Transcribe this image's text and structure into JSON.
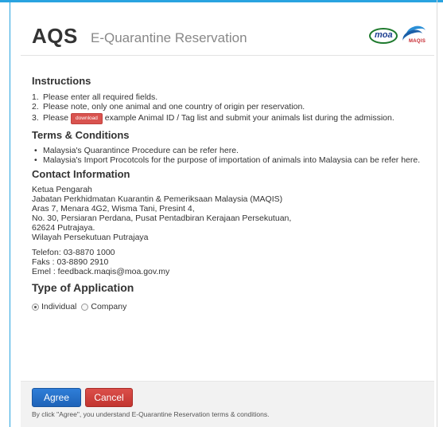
{
  "header": {
    "title_main": "AQS",
    "title_sub": "E-Quarantine Reservation",
    "logo_moa": "moa",
    "logo_maqis": "MAQIS"
  },
  "instructions": {
    "heading": "Instructions",
    "items": [
      {
        "num": "1.",
        "text": "Please enter all required fields."
      },
      {
        "num": "2.",
        "text": "Please note, only one animal and one country of origin per reservation."
      },
      {
        "num": "3.",
        "pre": "Please",
        "button": "download",
        "post": "example Animal ID / Tag list and submit your animals list during the admission."
      }
    ]
  },
  "terms": {
    "heading": "Terms & Conditions",
    "items": [
      "Malaysia's Quarantince Procedure can be refer here.",
      "Malaysia's Import Procotcols for the purpose of importation of animals into Malaysia can be refer here."
    ]
  },
  "contact": {
    "heading": "Contact Information",
    "address": [
      "Ketua Pengarah",
      "Jabatan Perkhidmatan Kuarantin & Pemeriksaan Malaysia (MAQIS)",
      "Aras 7, Menara 4G2, Wisma Tani, Presint 4,",
      "No. 30, Persiaran Perdana, Pusat Pentadbiran Kerajaan Persekutuan,",
      "62624 Putrajaya.",
      "Wilayah Persekutuan Putrajaya"
    ],
    "phone": "Telefon: 03-8870 1000",
    "fax": "Faks : 03-8890 2910",
    "email": "Emel : feedback.maqis@moa.gov.my"
  },
  "application": {
    "heading": "Type of Application",
    "options": [
      "Individual",
      "Company"
    ],
    "selected": "Individual"
  },
  "footer": {
    "agree_label": "Agree",
    "cancel_label": "Cancel",
    "note": "By click \"Agree\", you understand E-Quarantine Reservation terms & conditions."
  },
  "colors": {
    "frame_accent": "#29a3e0",
    "agree_button": "#2f7ed8",
    "cancel_button": "#d9534f",
    "download_button": "#d9534f"
  }
}
